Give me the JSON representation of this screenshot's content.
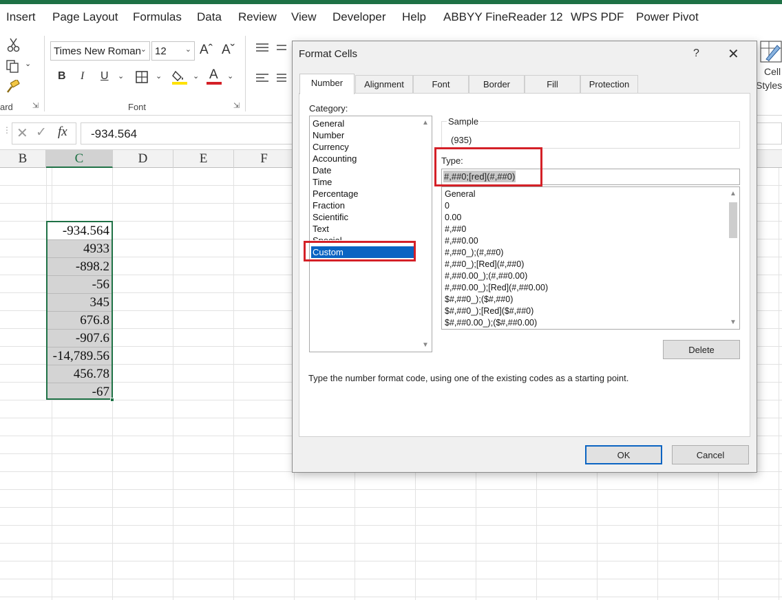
{
  "ribbon": {
    "tabs": [
      "Insert",
      "Page Layout",
      "Formulas",
      "Data",
      "Review",
      "View",
      "Developer",
      "Help",
      "ABBYY FineReader 12",
      "WPS PDF",
      "Power Pivot"
    ],
    "font_name": "Times New Roman",
    "font_size": "12",
    "clipboard_group_label": "ard",
    "font_group_label": "Font",
    "cell_styles_label_1": "Cell",
    "cell_styles_label_2": "Styles",
    "bold": "B",
    "italic": "I",
    "underline": "U",
    "font_color_letter": "A",
    "grow_font": "Aˆ",
    "shrink_font": "Aˇ"
  },
  "formula_bar": {
    "fx": "fx",
    "value": "-934.564"
  },
  "columns": [
    "B",
    "C",
    "D",
    "E",
    "F"
  ],
  "selected_column": "C",
  "cells": [
    "-934.564",
    "4933",
    "-898.2",
    "-56",
    "345",
    "676.8",
    "-907.6",
    "-14,789.56",
    "456.78",
    "-67"
  ],
  "dialog": {
    "title": "Format Cells",
    "help": "?",
    "tabs": [
      "Number",
      "Alignment",
      "Font",
      "Border",
      "Fill",
      "Protection"
    ],
    "active_tab": "Number",
    "category_label": "Category:",
    "categories": [
      "General",
      "Number",
      "Currency",
      "Accounting",
      "Date",
      "Time",
      "Percentage",
      "Fraction",
      "Scientific",
      "Text",
      "Special",
      "Custom"
    ],
    "selected_category": "Custom",
    "sample_label": "Sample",
    "sample_value": "(935)",
    "type_label": "Type:",
    "type_value": "#,##0;[red](#,##0)",
    "format_codes": [
      "General",
      "0",
      "0.00",
      "#,##0",
      "#,##0.00",
      "#,##0_);(#,##0)",
      "#,##0_);[Red](#,##0)",
      "#,##0.00_);(#,##0.00)",
      "#,##0.00_);[Red](#,##0.00)",
      "$#,##0_);($#,##0)",
      "$#,##0_);[Red]($#,##0)",
      "$#,##0.00_);($#,##0.00)"
    ],
    "delete_label": "Delete",
    "hint": "Type the number format code, using one of the existing codes as a starting point.",
    "ok_label": "OK",
    "cancel_label": "Cancel"
  },
  "colors": {
    "excel_green": "#1e7145",
    "selection_blue": "#0a64c2",
    "annotation_red": "#d42027"
  }
}
